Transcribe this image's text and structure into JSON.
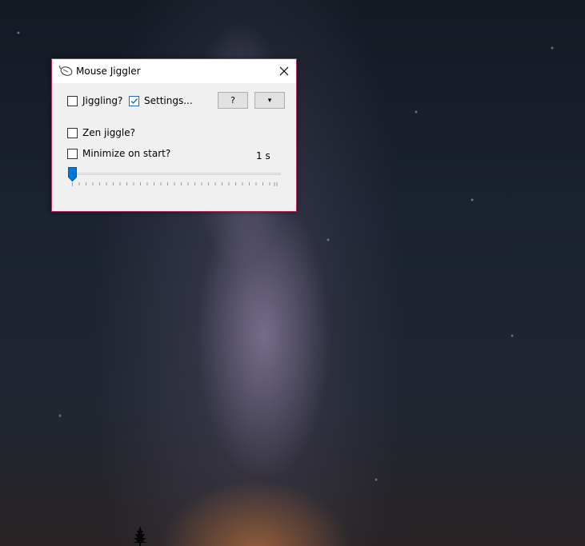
{
  "window": {
    "title": "Mouse Jiggler",
    "icon": "mouse-icon",
    "close_icon": "close-icon"
  },
  "controls": {
    "jiggling": {
      "label": "Jiggling?",
      "checked": false
    },
    "settings": {
      "label": "Settings...",
      "checked": true
    },
    "help_button": {
      "label": "?"
    },
    "dropdown_button": {
      "label": "▾"
    },
    "zen_jiggle": {
      "label": "Zen jiggle?",
      "checked": false
    },
    "minimize_on_start": {
      "label": "Minimize on start?",
      "checked": false
    }
  },
  "interval": {
    "label": "1 s",
    "slider_value": 1,
    "slider_min": 1,
    "slider_max": 60
  },
  "colors": {
    "window_border": "#b03060",
    "accent": "#1a6fd0"
  }
}
